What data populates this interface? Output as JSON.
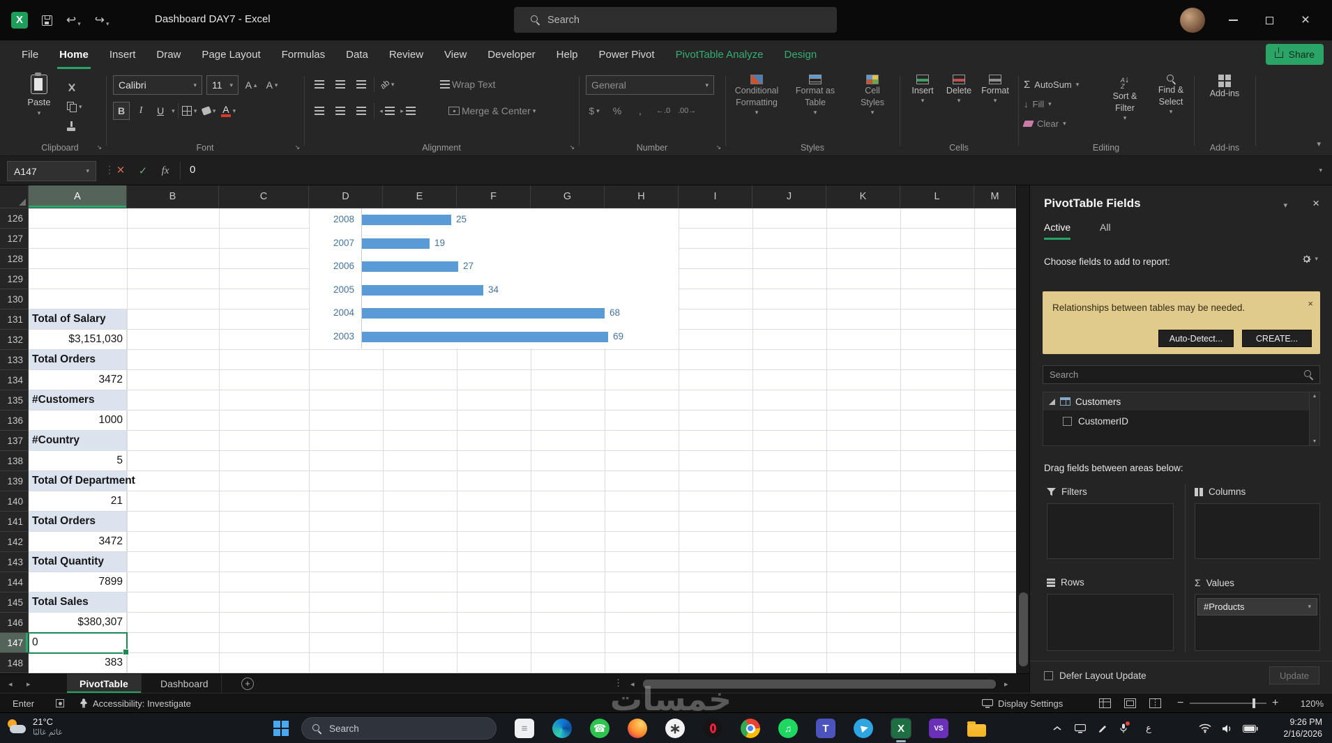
{
  "titlebar": {
    "app_title": "Dashboard DAY7 - Excel",
    "search_placeholder": "Search"
  },
  "share_button": "Share",
  "ribbon_tabs": [
    {
      "label": "File",
      "state": "normal"
    },
    {
      "label": "Home",
      "state": "active"
    },
    {
      "label": "Insert",
      "state": "normal"
    },
    {
      "label": "Draw",
      "state": "normal"
    },
    {
      "label": "Page Layout",
      "state": "normal"
    },
    {
      "label": "Formulas",
      "state": "normal"
    },
    {
      "label": "Data",
      "state": "normal"
    },
    {
      "label": "Review",
      "state": "normal"
    },
    {
      "label": "View",
      "state": "normal"
    },
    {
      "label": "Developer",
      "state": "normal"
    },
    {
      "label": "Help",
      "state": "normal"
    },
    {
      "label": "Power Pivot",
      "state": "normal"
    },
    {
      "label": "PivotTable Analyze",
      "state": "contextual"
    },
    {
      "label": "Design",
      "state": "contextual"
    }
  ],
  "ribbon": {
    "clipboard": {
      "paste": "Paste",
      "label": "Clipboard"
    },
    "font": {
      "name": "Calibri",
      "size": "11",
      "label": "Font"
    },
    "alignment": {
      "wrap": "Wrap Text",
      "merge": "Merge & Center",
      "label": "Alignment"
    },
    "number": {
      "format": "General",
      "label": "Number"
    },
    "styles": {
      "cf1": "Conditional",
      "cf2": "Formatting",
      "ft1": "Format as",
      "ft2": "Table",
      "cs1": "Cell",
      "cs2": "Styles",
      "label": "Styles"
    },
    "cells": {
      "insert": "Insert",
      "delete": "Delete",
      "format": "Format",
      "label": "Cells"
    },
    "editing": {
      "autosum": "AutoSum",
      "fill": "Fill",
      "clear": "Clear",
      "sf1": "Sort &",
      "sf2": "Filter",
      "fs1": "Find &",
      "fs2": "Select",
      "label": "Editing"
    },
    "addins": {
      "button": "Add-ins",
      "label": "Add-ins"
    }
  },
  "formula_bar": {
    "name_box": "A147",
    "fx": "fx",
    "content": "0"
  },
  "grid": {
    "columns": [
      "A",
      "B",
      "C",
      "D",
      "E",
      "F",
      "G",
      "H",
      "I",
      "J",
      "K",
      "L",
      "M"
    ],
    "selected_column": "A",
    "selected_row": 147,
    "selected_cell": "A147",
    "rows": [
      {
        "num": 126,
        "a": "",
        "type": "empty"
      },
      {
        "num": 127,
        "a": "",
        "type": "empty"
      },
      {
        "num": 128,
        "a": "",
        "type": "empty"
      },
      {
        "num": 129,
        "a": "",
        "type": "empty"
      },
      {
        "num": 130,
        "a": "",
        "type": "empty"
      },
      {
        "num": 131,
        "a": "Total of Salary",
        "type": "label"
      },
      {
        "num": 132,
        "a": "$3,151,030",
        "type": "number"
      },
      {
        "num": 133,
        "a": "Total Orders",
        "type": "label"
      },
      {
        "num": 134,
        "a": "3472",
        "type": "number"
      },
      {
        "num": 135,
        "a": "#Customers",
        "type": "label"
      },
      {
        "num": 136,
        "a": "1000",
        "type": "number"
      },
      {
        "num": 137,
        "a": "#Country",
        "type": "label"
      },
      {
        "num": 138,
        "a": "5",
        "type": "number"
      },
      {
        "num": 139,
        "a": "Total Of Department",
        "type": "label"
      },
      {
        "num": 140,
        "a": "21",
        "type": "number"
      },
      {
        "num": 141,
        "a": "Total Orders",
        "type": "label"
      },
      {
        "num": 142,
        "a": "3472",
        "type": "number"
      },
      {
        "num": 143,
        "a": "Total Quantity",
        "type": "label"
      },
      {
        "num": 144,
        "a": "7899",
        "type": "number"
      },
      {
        "num": 145,
        "a": "Total Sales",
        "type": "label"
      },
      {
        "num": 146,
        "a": "$380,307",
        "type": "number"
      },
      {
        "num": 147,
        "a": "0",
        "type": "selected"
      },
      {
        "num": 148,
        "a": "383",
        "type": "number"
      }
    ]
  },
  "chart_data": {
    "type": "bar",
    "orientation": "horizontal",
    "categories": [
      "2008",
      "2007",
      "2006",
      "2005",
      "2004",
      "2003"
    ],
    "values": [
      25,
      19,
      27,
      34,
      68,
      69
    ],
    "bar_color": "#5b9bd5",
    "label_color": "#44739e",
    "note": "embedded chart, top edge scrolled out of view"
  },
  "pivot_pane": {
    "title": "PivotTable Fields",
    "tabs": [
      {
        "label": "Active",
        "active": true
      },
      {
        "label": "All",
        "active": false
      }
    ],
    "choose_text": "Choose fields to add to report:",
    "warning": {
      "text": "Relationships between tables may be needed.",
      "auto_detect": "Auto-Detect...",
      "create": "CREATE..."
    },
    "search_placeholder": "Search",
    "field_tree": {
      "table": "Customers",
      "fields": [
        {
          "name": "CustomerID",
          "checked": false
        }
      ]
    },
    "drag_text": "Drag fields between areas below:",
    "areas": {
      "filters": "Filters",
      "columns": "Columns",
      "rows": "Rows",
      "values": "Values"
    },
    "values_items": [
      {
        "label": "#Products"
      }
    ],
    "defer_label": "Defer Layout Update",
    "update_button": "Update"
  },
  "sheet_tabs": {
    "tabs": [
      {
        "label": "PivotTable",
        "active": true
      },
      {
        "label": "Dashboard",
        "active": false
      }
    ]
  },
  "status_bar": {
    "mode": "Enter",
    "accessibility": "Accessibility: Investigate",
    "display_settings": "Display Settings",
    "zoom": "120%"
  },
  "taskbar": {
    "weather": {
      "temp": "21°C",
      "condition": "غائم غالبًا"
    },
    "search": "Search",
    "app_icons": [
      "notepad",
      "edge",
      "whatsapp",
      "firefox",
      "chatgpt",
      "opera",
      "chrome",
      "spotify",
      "teams",
      "telegram",
      "excel",
      "visual-studio",
      "folder"
    ],
    "language": "ع",
    "clock": {
      "time": "9:26 PM",
      "date": "2/16/2026"
    }
  },
  "watermark": "خمسات",
  "colors": {
    "accent_green": "#27a568",
    "bar_blue": "#5b9bd5",
    "warning_bg": "#e0cb8c",
    "label_cell_bg": "#dbe3ee"
  }
}
